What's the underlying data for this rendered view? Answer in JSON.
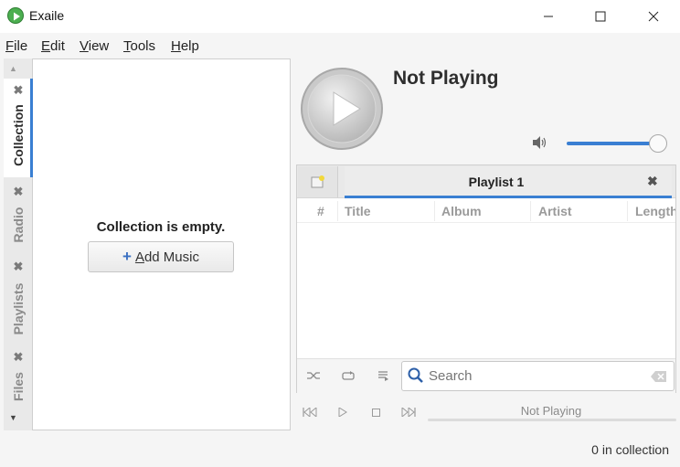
{
  "window": {
    "title": "Exaile",
    "minimize_icon": "minimize-icon",
    "maximize_icon": "maximize-icon",
    "close_icon": "close-icon"
  },
  "menu": {
    "items": [
      {
        "label": "File",
        "accel": "F",
        "rest": "ile"
      },
      {
        "label": "Edit",
        "accel": "E",
        "rest": "dit"
      },
      {
        "label": "View",
        "accel": "V",
        "rest": "iew"
      },
      {
        "label": "Tools",
        "accel": "T",
        "rest": "ools"
      },
      {
        "label": "Help",
        "accel": "H",
        "rest": "elp"
      }
    ]
  },
  "side_tabs": [
    {
      "label": "Collection",
      "active": true
    },
    {
      "label": "Radio",
      "active": false
    },
    {
      "label": "Playlists",
      "active": false
    },
    {
      "label": "Files",
      "active": false
    }
  ],
  "collection": {
    "empty_message": "Collection is empty.",
    "add_button_plus": "+",
    "add_button_accel": "A",
    "add_button_rest": "dd Music"
  },
  "now_playing": {
    "title": "Not Playing",
    "volume_level": 1.0
  },
  "playlist": {
    "tab_label": "Playlist 1",
    "columns": [
      "#",
      "Title",
      "Album",
      "Artist",
      "Length"
    ]
  },
  "search": {
    "placeholder": "Search"
  },
  "transport": {
    "progress_text": "Not Playing",
    "progress": 0
  },
  "status": {
    "text": "0 in collection"
  },
  "colors": {
    "accent": "#3a7fd2",
    "app_icon": "#4caf50"
  }
}
